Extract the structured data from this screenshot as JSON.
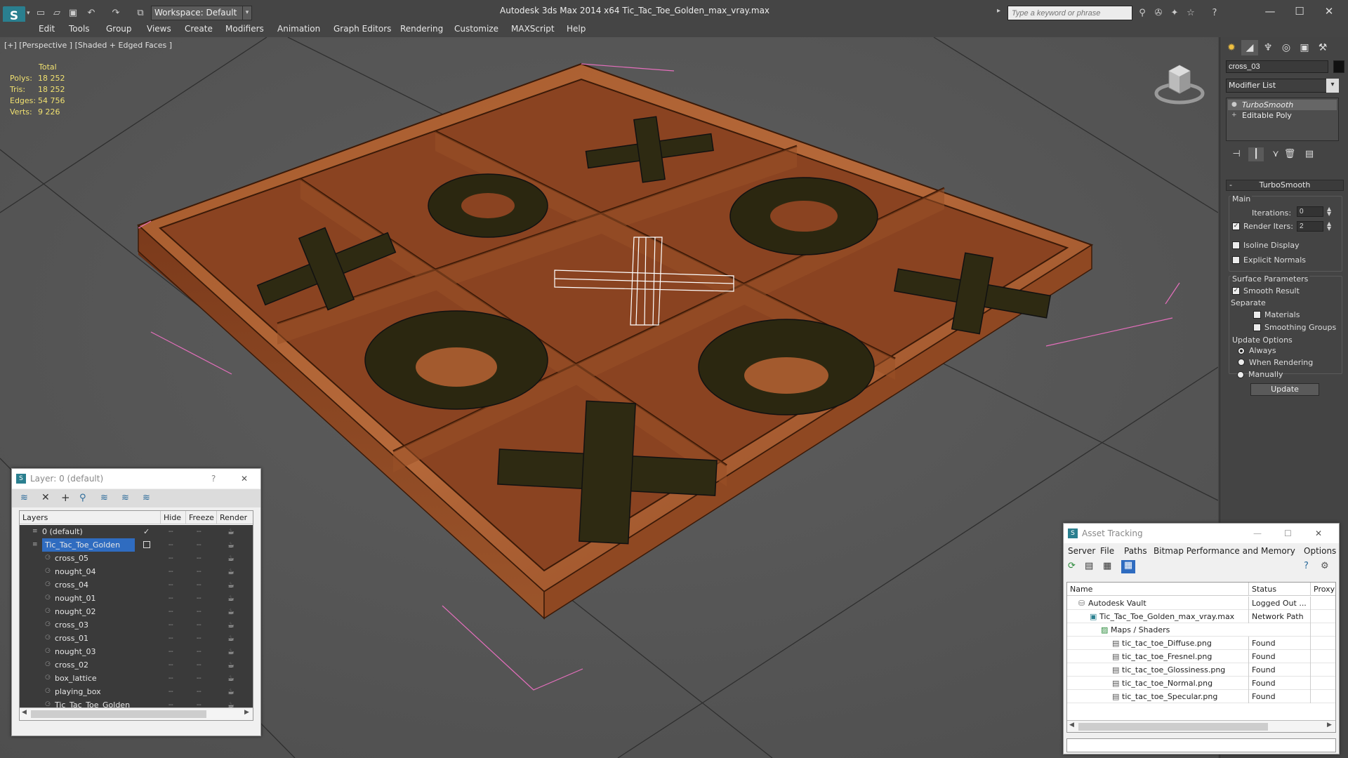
{
  "app": {
    "title": "Autodesk 3ds Max  2014 x64      Tic_Tac_Toe_Golden_max_vray.max",
    "logo_letter": "S",
    "workspace": "Workspace: Default",
    "search_placeholder": "Type a keyword or phrase",
    "quick_access_icons": [
      "new-file-icon",
      "open-folder-icon",
      "save-icon",
      "undo-icon",
      "redo-icon",
      "project-folder-icon"
    ],
    "menu": [
      "Edit",
      "Tools",
      "Group",
      "Views",
      "Create",
      "Modifiers",
      "Animation",
      "Graph Editors",
      "Rendering",
      "Customize",
      "MAXScript",
      "Help"
    ]
  },
  "viewport": {
    "label": "[+] [Perspective ] [Shaded + Edged Faces ]",
    "stats": {
      "header": "Total",
      "rows": [
        {
          "label": "Polys:",
          "value": "18 252"
        },
        {
          "label": "Tris:",
          "value": "18 252"
        },
        {
          "label": "Edges:",
          "value": "54 756"
        },
        {
          "label": "Verts:",
          "value": "9 226"
        }
      ]
    }
  },
  "command_panel": {
    "object_name": "cross_03",
    "modifier_list": "Modifier List",
    "stack": [
      "TurboSmooth",
      "Editable Poly"
    ],
    "rollout_title": "TurboSmooth",
    "main_label": "Main",
    "iterations_label": "Iterations:",
    "iterations_value": "0",
    "render_iters_label": "Render Iters:",
    "render_iters_value": "2",
    "isoline": "Isoline Display",
    "explicit_normals": "Explicit Normals",
    "surface_label": "Surface Parameters",
    "smooth_result": "Smooth Result",
    "separate_label": "Separate",
    "materials": "Materials",
    "smoothing_groups": "Smoothing Groups",
    "update_options_label": "Update Options",
    "always": "Always",
    "when_rendering": "When Rendering",
    "manually": "Manually",
    "update_button": "Update"
  },
  "layer_dialog": {
    "title": "Layer: 0 (default)",
    "help": "?",
    "close": "✕",
    "columns": {
      "layers": "Layers",
      "hide": "Hide",
      "freeze": "Freeze",
      "render": "Render"
    },
    "rows": [
      {
        "name": "0 (default)",
        "level": 0
      },
      {
        "name": "Tic_Tac_Toe_Golden",
        "level": 0
      },
      {
        "name": "cross_05",
        "level": 1
      },
      {
        "name": "nought_04",
        "level": 1
      },
      {
        "name": "cross_04",
        "level": 1
      },
      {
        "name": "nought_01",
        "level": 1
      },
      {
        "name": "nought_02",
        "level": 1
      },
      {
        "name": "cross_03",
        "level": 1
      },
      {
        "name": "cross_01",
        "level": 1
      },
      {
        "name": "nought_03",
        "level": 1
      },
      {
        "name": "cross_02",
        "level": 1
      },
      {
        "name": "box_lattice",
        "level": 1
      },
      {
        "name": "playing_box",
        "level": 1
      },
      {
        "name": "Tic_Tac_Toe_Golden",
        "level": 1
      }
    ]
  },
  "asset_tracking": {
    "title": "Asset Tracking",
    "menu": [
      "Server",
      "File",
      "Paths",
      "Bitmap Performance and Memory",
      "Options"
    ],
    "columns": {
      "name": "Name",
      "status": "Status",
      "proxy": "Proxy"
    },
    "rows": [
      {
        "name": "Autodesk Vault",
        "status": "Logged Out ...",
        "level": 1,
        "icon": "vault-icon"
      },
      {
        "name": "Tic_Tac_Toe_Golden_max_vray.max",
        "status": "Network Path",
        "level": 2,
        "icon": "max-file-icon"
      },
      {
        "name": "Maps / Shaders",
        "status": "",
        "level": 3,
        "icon": "maps-icon"
      },
      {
        "name": "tic_tac_toe_Diffuse.png",
        "status": "Found",
        "level": 4,
        "icon": "image-file-icon"
      },
      {
        "name": "tic_tac_toe_Fresnel.png",
        "status": "Found",
        "level": 4,
        "icon": "image-file-icon"
      },
      {
        "name": "tic_tac_toe_Glossiness.png",
        "status": "Found",
        "level": 4,
        "icon": "image-file-icon"
      },
      {
        "name": "tic_tac_toe_Normal.png",
        "status": "Found",
        "level": 4,
        "icon": "image-file-icon"
      },
      {
        "name": "tic_tac_toe_Specular.png",
        "status": "Found",
        "level": 4,
        "icon": "image-file-icon"
      }
    ]
  }
}
